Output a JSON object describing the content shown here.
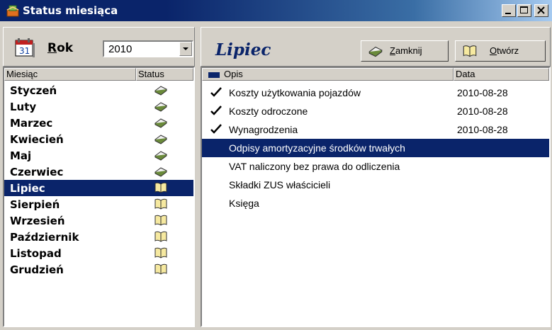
{
  "window": {
    "title": "Status miesiąca",
    "controls": [
      "minimize",
      "maximize",
      "close"
    ]
  },
  "left_pane": {
    "year_label_prefix": "R",
    "year_label_rest": "ok",
    "year_value": "2010",
    "columns": {
      "month": "Miesiąc",
      "status": "Status"
    },
    "months": [
      {
        "name": "Styczeń",
        "status_icon": "closed-book-icon"
      },
      {
        "name": "Luty",
        "status_icon": "closed-book-icon"
      },
      {
        "name": "Marzec",
        "status_icon": "closed-book-icon"
      },
      {
        "name": "Kwiecień",
        "status_icon": "closed-book-icon"
      },
      {
        "name": "Maj",
        "status_icon": "closed-book-icon"
      },
      {
        "name": "Czerwiec",
        "status_icon": "closed-book-icon"
      },
      {
        "name": "Lipiec",
        "status_icon": "open-book-icon",
        "selected": true
      },
      {
        "name": "Sierpień",
        "status_icon": "open-book-icon"
      },
      {
        "name": "Wrzesień",
        "status_icon": "open-book-icon"
      },
      {
        "name": "Październik",
        "status_icon": "open-book-icon"
      },
      {
        "name": "Listopad",
        "status_icon": "open-book-icon"
      },
      {
        "name": "Grudzień",
        "status_icon": "open-book-icon"
      }
    ]
  },
  "right_pane": {
    "month_title": "Lipiec",
    "close_button": {
      "hotkey": "Z",
      "rest": "amknij",
      "icon": "closed-book-icon"
    },
    "open_button": {
      "hotkey": "O",
      "rest": "twórz",
      "icon": "open-book-icon"
    },
    "columns": {
      "description": "Opis",
      "date": "Data"
    },
    "items": [
      {
        "description": "Koszty użytkowania pojazdów",
        "date": "2010-08-28",
        "checked": true
      },
      {
        "description": "Koszty odroczone",
        "date": "2010-08-28",
        "checked": true
      },
      {
        "description": "Wynagrodzenia",
        "date": "2010-08-28",
        "checked": true
      },
      {
        "description": "Odpisy amortyzacyjne środków trwałych",
        "date": "",
        "checked": false,
        "selected": true
      },
      {
        "description": "VAT naliczony bez prawa do odliczenia",
        "date": "",
        "checked": false
      },
      {
        "description": "Składki ZUS właścicieli",
        "date": "",
        "checked": false
      },
      {
        "description": "Księga",
        "date": "",
        "checked": false
      }
    ]
  },
  "colors": {
    "selection": "#0a246a",
    "face": "#d4d0c8",
    "title_text": "#0a246a"
  }
}
